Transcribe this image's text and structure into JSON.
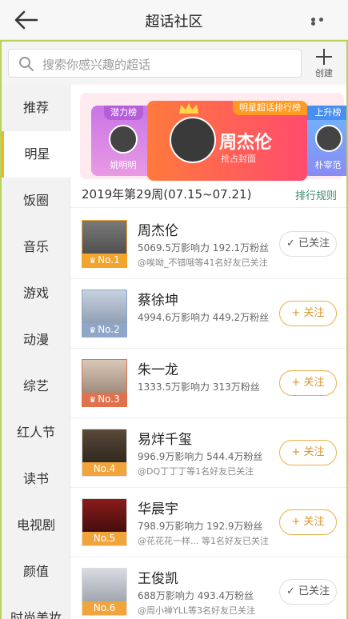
{
  "header": {
    "title": "超话社区",
    "back_icon": "back-arrow-icon",
    "more_icon": "more-dots-icon"
  },
  "search": {
    "placeholder": "搜索你感兴趣的超话",
    "create_label": "创建"
  },
  "sidebar": {
    "items": [
      {
        "label": "推荐"
      },
      {
        "label": "明星"
      },
      {
        "label": "饭圈"
      },
      {
        "label": "音乐"
      },
      {
        "label": "游戏"
      },
      {
        "label": "动漫"
      },
      {
        "label": "综艺"
      },
      {
        "label": "红人节"
      },
      {
        "label": "读书"
      },
      {
        "label": "电视剧"
      },
      {
        "label": "颜值"
      },
      {
        "label": "时尚美妆"
      }
    ],
    "active_index": 1
  },
  "banner": {
    "left": {
      "tag": "潜力榜",
      "name": "姚明明"
    },
    "mid": {
      "tag": "明星超话排行榜",
      "name": "周杰伦",
      "sub": "抢占封面"
    },
    "right": {
      "tag": "上升榜",
      "name": "朴宰范"
    }
  },
  "ranking": {
    "week": "2019年第29周(07.15~07.21)",
    "rule_label": "排行规则",
    "rows": [
      {
        "rank": "No.1",
        "name": "周杰伦",
        "stats": "5069.5万影响力 192.1万粉丝",
        "friends": "@唉呦_不错哦等41名好友已关注",
        "button": "✓ 已关注",
        "followed": true
      },
      {
        "rank": "No.2",
        "name": "蔡徐坤",
        "stats": "4994.6万影响力 449.2万粉丝",
        "friends": "",
        "button": "+ 关注",
        "followed": false
      },
      {
        "rank": "No.3",
        "name": "朱一龙",
        "stats": "1333.5万影响力 313万粉丝",
        "friends": "",
        "button": "+ 关注",
        "followed": false
      },
      {
        "rank": "No.4",
        "name": "易烊千玺",
        "stats": "996.9万影响力 544.4万粉丝",
        "friends": "@DQ丁丁丁等1名好友已关注",
        "button": "+ 关注",
        "followed": false
      },
      {
        "rank": "No.5",
        "name": "华晨宇",
        "stats": "798.9万影响力 192.9万粉丝",
        "friends": "@花花花一样...  等1名好友已关注",
        "button": "+ 关注",
        "followed": false
      },
      {
        "rank": "No.6",
        "name": "王俊凯",
        "stats": "688万影响力 493.4万粉丝",
        "friends": "@周小禅YLL等3名好友已关注",
        "button": "✓ 已关注",
        "followed": true
      }
    ]
  },
  "colors": {
    "accent": "#e8b04a",
    "sidebar_active": "#f0b429",
    "rank1": "#f3a42c",
    "rank2": "#8fa6c8",
    "rank3": "#e0714d",
    "rank_other": "#f1a43a"
  }
}
